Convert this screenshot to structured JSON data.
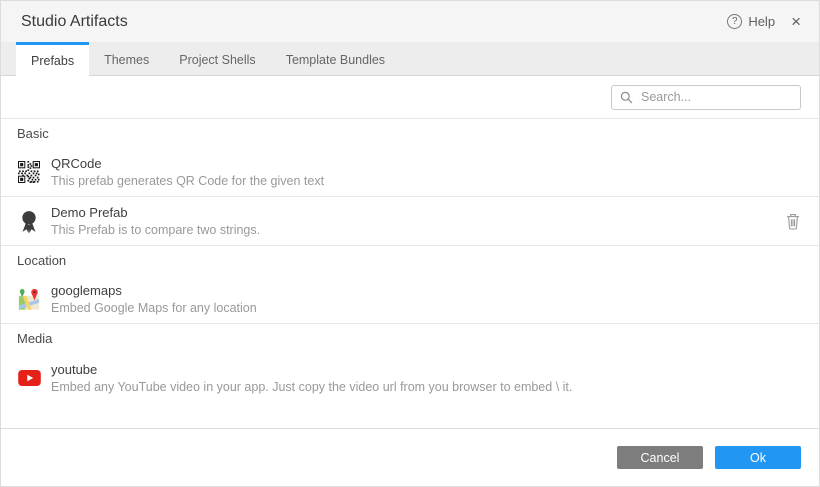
{
  "dialog": {
    "title": "Studio Artifacts",
    "help_label": "Help",
    "help_glyph": "?",
    "close_glyph": "×"
  },
  "tabs": [
    {
      "label": "Prefabs",
      "active": true
    },
    {
      "label": "Themes",
      "active": false
    },
    {
      "label": "Project Shells",
      "active": false
    },
    {
      "label": "Template Bundles",
      "active": false
    }
  ],
  "search": {
    "placeholder": "Search...",
    "icon": "search-icon"
  },
  "sections": [
    {
      "name": "Basic",
      "items": [
        {
          "title": "QRCode",
          "description": "This prefab generates QR Code for the given text",
          "icon": "qrcode-icon",
          "deletable": false
        },
        {
          "title": "Demo Prefab",
          "description": "This Prefab is to compare two strings.",
          "icon": "award-ribbon-icon",
          "deletable": true
        }
      ]
    },
    {
      "name": "Location",
      "items": [
        {
          "title": "googlemaps",
          "description": "Embed Google Maps for any location",
          "icon": "google-maps-icon",
          "deletable": false
        }
      ]
    },
    {
      "name": "Media",
      "items": [
        {
          "title": "youtube",
          "description": "Embed any YouTube video in your app. Just copy the video url from you browser to embed \\ it.",
          "icon": "youtube-icon",
          "deletable": false
        }
      ]
    }
  ],
  "footer": {
    "cancel_label": "Cancel",
    "ok_label": "Ok"
  },
  "colors": {
    "accent": "#2196f3",
    "cancel_button": "#7d7d7d",
    "youtube_red": "#e62117",
    "header_bg": "#f5f5f5",
    "tabbar_bg": "#ededed"
  }
}
